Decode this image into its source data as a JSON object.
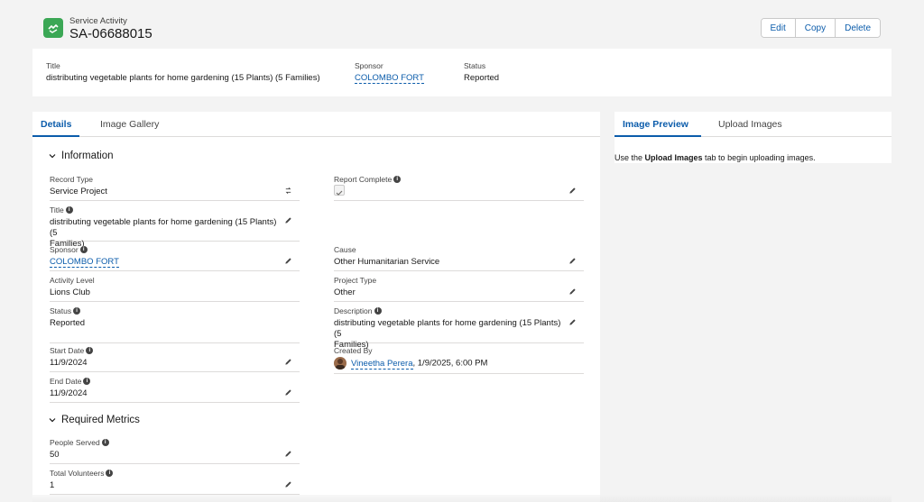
{
  "header": {
    "record_type": "Service Activity",
    "record_name": "SA-06688015",
    "icon": "service-activity-icon",
    "buttons": {
      "edit": "Edit",
      "copy": "Copy",
      "delete": "Delete"
    }
  },
  "highlights": {
    "title_label": "Title",
    "title_value": "distributing vegetable plants for home gardening (15 Plants) (5 Families)",
    "sponsor_label": "Sponsor",
    "sponsor_value": "COLOMBO FORT",
    "status_label": "Status",
    "status_value": "Reported"
  },
  "main_tabs": {
    "details": "Details",
    "gallery": "Image Gallery"
  },
  "sections": {
    "information": "Information",
    "metrics": "Required Metrics"
  },
  "fields": {
    "record_type": {
      "label": "Record Type",
      "value": "Service Project"
    },
    "report_complete": {
      "label": "Report Complete"
    },
    "title": {
      "label": "Title",
      "value_line1": "distributing vegetable plants for home gardening (15 Plants) (5",
      "value_line2": "Families)"
    },
    "sponsor": {
      "label": "Sponsor",
      "value": "COLOMBO FORT"
    },
    "cause": {
      "label": "Cause",
      "value": "Other Humanitarian Service"
    },
    "activity_level": {
      "label": "Activity Level",
      "value": "Lions Club"
    },
    "project_type": {
      "label": "Project Type",
      "value": "Other"
    },
    "status": {
      "label": "Status",
      "value": "Reported"
    },
    "description": {
      "label": "Description",
      "value_line1": "distributing vegetable plants for home gardening (15 Plants) (5",
      "value_line2": "Families)"
    },
    "start_date": {
      "label": "Start Date",
      "value": "11/9/2024"
    },
    "created_by": {
      "label": "Created By",
      "user": "Vineetha Perera",
      "date": ", 1/9/2025, 6:00 PM"
    },
    "end_date": {
      "label": "End Date",
      "value": "11/9/2024"
    },
    "people_served": {
      "label": "People Served",
      "value": "50"
    },
    "total_volunteers": {
      "label": "Total Volunteers",
      "value": "1"
    }
  },
  "side_tabs": {
    "preview": "Image Preview",
    "upload": "Upload Images"
  },
  "side_message": {
    "prefix": "Use the ",
    "bold": "Upload Images",
    "suffix": " tab to begin uploading images."
  },
  "colors": {
    "accent": "#0b5cab",
    "icon_bg": "#3ba755"
  }
}
